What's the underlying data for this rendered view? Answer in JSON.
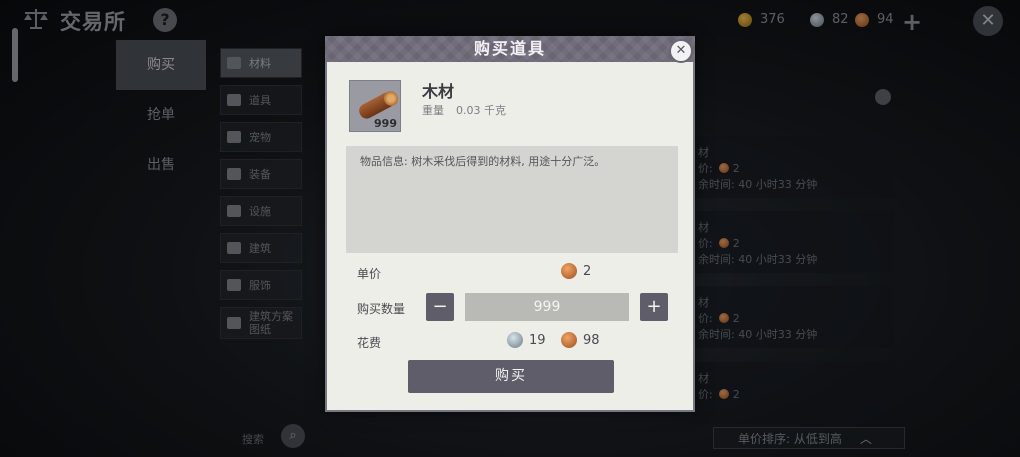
{
  "header": {
    "title": "交易所",
    "help": "?"
  },
  "currency": {
    "gold": "376",
    "silver": "82",
    "copper": "94"
  },
  "main_tabs": [
    {
      "label": "购买"
    },
    {
      "label": "抢单"
    },
    {
      "label": "出售"
    }
  ],
  "categories": [
    {
      "label": "材料"
    },
    {
      "label": "道具"
    },
    {
      "label": "宠物"
    },
    {
      "label": "装备"
    },
    {
      "label": "设施"
    },
    {
      "label": "建筑"
    },
    {
      "label": "服饰"
    },
    {
      "label": "建筑方案图纸"
    }
  ],
  "search": {
    "label": "搜索"
  },
  "listings": [
    {
      "l1": "材",
      "price_label": "价:",
      "price": "2",
      "time": "余时间: 40 小时33 分钟"
    },
    {
      "l1": "材",
      "price_label": "价:",
      "price": "2",
      "time": "余时间: 40 小时33 分钟"
    },
    {
      "l1": "材",
      "price_label": "价:",
      "price": "2",
      "time": "余时间: 40 小时33 分钟"
    },
    {
      "l1": "材",
      "price_label": "价:",
      "price": "2",
      "time": ""
    }
  ],
  "sort": {
    "label": "单价排序: 从低到高"
  },
  "modal": {
    "title": "购买道具",
    "item_name": "木材",
    "item_count": "999",
    "weight_label": "重量",
    "weight_value": "0.03 千克",
    "description": "物品信息: 树木采伐后得到的材料, 用途十分广泛。",
    "unit_price_label": "单价",
    "unit_price": "2",
    "quantity_label": "购买数量",
    "quantity": "999",
    "cost_label": "花费",
    "cost_silver": "19",
    "cost_copper": "98",
    "buy_label": "购买"
  },
  "colors": {
    "modal_header": "#6a6573",
    "button": "#5f5d6a",
    "modal_bg": "#eeeee8"
  }
}
